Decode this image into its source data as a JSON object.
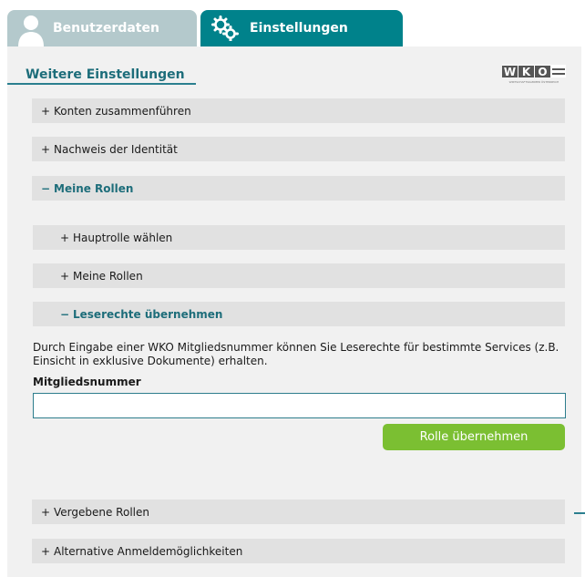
{
  "tabs": [
    {
      "label": "Benutzerdaten",
      "icon": "user-icon",
      "active": false
    },
    {
      "label": "Einstellungen",
      "icon": "gear-icon",
      "active": true
    }
  ],
  "colors": {
    "accent": "#00828b",
    "title": "#1d6d7a",
    "button": "#7bbf32",
    "row": "#e1e1e1",
    "panel": "#f1f1f1"
  },
  "panel": {
    "title": "Weitere Einstellungen",
    "logo": "WKO",
    "logo_tagline": "WIRTSCHAFTSKAMMER ÖSTERREICH",
    "sections": [
      {
        "sign": "+",
        "label": "Konten zusammenführen"
      },
      {
        "sign": "+",
        "label": "Nachweis der Identität"
      },
      {
        "sign": "−",
        "label": "Meine Rollen"
      },
      {
        "sign": "+",
        "label": "Hauptrolle wählen"
      },
      {
        "sign": "+",
        "label": "Meine Rollen"
      },
      {
        "sign": "−",
        "label": "Leserechte übernehmen"
      },
      {
        "sign": "+",
        "label": "Vergebene Rollen"
      },
      {
        "sign": "+",
        "label": "Alternative Anmeldemöglichkeiten"
      }
    ],
    "leserechte": {
      "description": "Durch Eingabe einer WKO Mitgliedsnummer können Sie Leserechte für bestimmte Services (z.B. Einsicht in exklusive Dokumente) erhalten.",
      "field_label": "Mitgliedsnummer",
      "field_value": "",
      "button_label": "Rolle übernehmen"
    }
  }
}
